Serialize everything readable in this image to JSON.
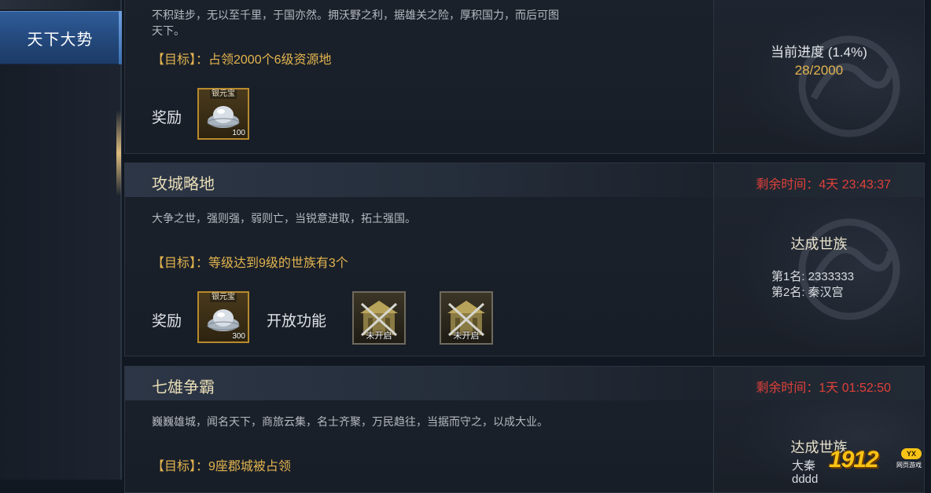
{
  "sidebar": {
    "active_tab": "天下大势"
  },
  "missions": [
    {
      "title": "",
      "description_lines": [
        "不积跬步，无以至千里，于国亦然。拥沃野之利，据雄关之险，厚积国力，而后可图",
        "天下。"
      ],
      "goal": "【目标】：占领2000个6级资源地",
      "reward_label": "奖励",
      "rewards": [
        {
          "tag": "银元宝",
          "qty": "100"
        }
      ],
      "progress_label": "当前进度 (1.4%)",
      "progress_value": "28/2000",
      "progress_fraction": 0.014
    },
    {
      "title": "攻城略地",
      "remaining": "剩余时间：4天 23:43:37",
      "description_lines": [
        "大争之世，强则强，弱则亡，当锐意进取，拓土强国。"
      ],
      "goal": "【目标】：等级达到9级的世族有3个",
      "reward_label": "奖励",
      "rewards": [
        {
          "tag": "银元宝",
          "qty": "300"
        }
      ],
      "open_label": "开放功能",
      "functions": [
        {
          "status": "未开启"
        },
        {
          "status": "未开启"
        }
      ],
      "clan_title": "达成世族",
      "ranks": [
        "第1名: 2333333",
        "第2名: 秦汉宫"
      ]
    },
    {
      "title": "七雄争霸",
      "remaining": "剩余时间：1天 01:52:50",
      "description_lines": [
        "巍巍雄城，闻名天下，商旅云集，名士齐聚，万民趋往，当据而守之，以成大业。"
      ],
      "goal": "【目标】：9座郡城被占领",
      "clan_title": "达成世族",
      "ranks": [
        "大秦",
        "dddd"
      ]
    }
  ],
  "watermark": {
    "number": "1912",
    "badge": "YX",
    "sub": "网页游戏"
  },
  "colors": {
    "accent_gold": "#e3b44f",
    "timer_red": "#e0403a",
    "tab_blue": "#2f5d9a"
  }
}
